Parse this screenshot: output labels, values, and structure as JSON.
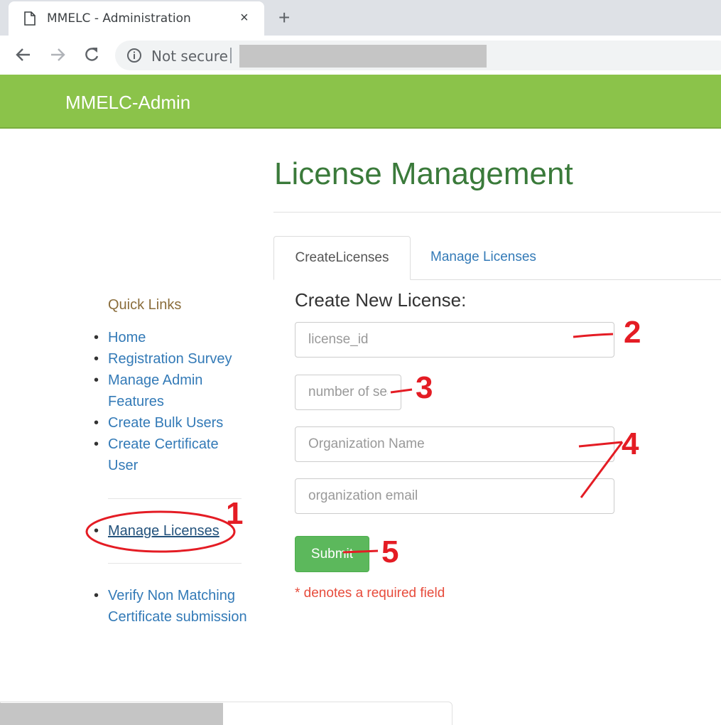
{
  "browser": {
    "tab_title": "MMELC - Administration",
    "tab_close": "×",
    "new_tab": "+",
    "security_label": "Not secure"
  },
  "header": {
    "brand": "MMELC-Admin"
  },
  "sidebar": {
    "title": "Quick Links",
    "links": [
      {
        "label": "Home"
      },
      {
        "label": "Registration Survey"
      },
      {
        "label": "Manage Admin Features"
      },
      {
        "label": "Create Bulk Users"
      },
      {
        "label": "Create Certificate User"
      }
    ],
    "manage_licenses": "Manage Licenses",
    "verify": "Verify Non Matching Certificate submission"
  },
  "main": {
    "title": "License Management",
    "tabs": [
      {
        "label": "CreateLicenses"
      },
      {
        "label": "Manage Licenses"
      }
    ],
    "form": {
      "heading": "Create New License:",
      "license_id_placeholder": "license_id",
      "seats_placeholder": "number of seats",
      "org_name_placeholder": "Organization Name",
      "org_email_placeholder": "organization email",
      "submit_label": "Submit",
      "required_note": "* denotes a required field"
    }
  },
  "annotations": {
    "color": "#e41c24",
    "labels": [
      "1",
      "2",
      "3",
      "4",
      "5"
    ]
  }
}
